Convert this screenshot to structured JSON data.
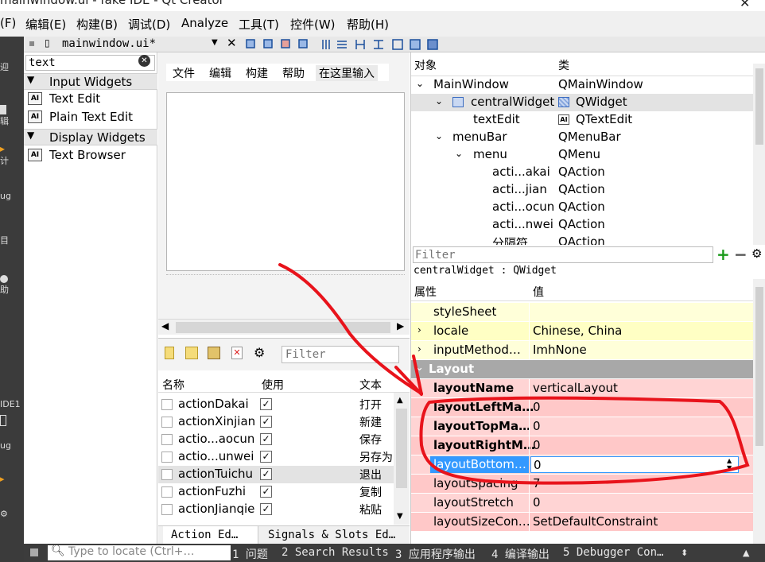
{
  "title_bar": {
    "text": "mainwindow.ui - fake IDE - Qt Creator",
    "close": "✕"
  },
  "menu_bar": [
    "(F)",
    "编辑(E)",
    "构建(B)",
    "调试(D)",
    "Analyze",
    "工具(T)",
    "控件(W)",
    "帮助(H)"
  ],
  "mode_bar": [
    "迎",
    "辑",
    "计",
    "ug",
    "目",
    "助",
    "IDE1",
    "ug"
  ],
  "editor_tab": {
    "file": "mainwindow.ui*"
  },
  "widget_box": {
    "search_value": "text",
    "categories": [
      {
        "label": "Input Widgets",
        "items": [
          "Text Edit",
          "Plain Text Edit"
        ]
      },
      {
        "label": "Display Widgets",
        "items": [
          "Text Browser"
        ]
      }
    ],
    "icon_text": "AI"
  },
  "form": {
    "menu": [
      "文件",
      "编辑",
      "构建",
      "帮助",
      "在这里输入"
    ]
  },
  "action_editor": {
    "filter_placeholder": "Filter",
    "columns": [
      "名称",
      "使用",
      "文本"
    ],
    "rows": [
      {
        "name": "actionDakai",
        "text": "打开"
      },
      {
        "name": "actionXinjian",
        "text": "新建"
      },
      {
        "name": "actio...aocun",
        "text": "保存"
      },
      {
        "name": "actio...unwei",
        "text": "另存为"
      },
      {
        "name": "actionTuichu",
        "text": "退出"
      },
      {
        "name": "actionFuzhi",
        "text": "复制"
      },
      {
        "name": "actionJianqie",
        "text": "粘贴"
      }
    ],
    "tabs": [
      "Action Ed…",
      "Signals & Slots Ed…"
    ]
  },
  "object_inspector": {
    "columns": [
      "对象",
      "类"
    ],
    "rows": [
      {
        "object": "MainWindow",
        "class": "QMainWindow"
      },
      {
        "object": "centralWidget",
        "class": "QWidget"
      },
      {
        "object": "textEdit",
        "class": "QTextEdit"
      },
      {
        "object": "menuBar",
        "class": "QMenuBar"
      },
      {
        "object": "menu",
        "class": "QMenu"
      },
      {
        "object": "acti...akai",
        "class": "QAction"
      },
      {
        "object": "acti...jian",
        "class": "QAction"
      },
      {
        "object": "acti...ocun",
        "class": "QAction"
      },
      {
        "object": "acti...nwei",
        "class": "QAction"
      },
      {
        "object": "分隔符",
        "class": "QAction"
      }
    ]
  },
  "property_editor": {
    "filter_placeholder": "Filter",
    "context": "centralWidget : QWidget",
    "columns": [
      "属性",
      "值"
    ],
    "rows": [
      {
        "name": "styleSheet",
        "value": ""
      },
      {
        "name": "locale",
        "value": "Chinese, China"
      },
      {
        "name": "inputMethod…",
        "value": "ImhNone"
      }
    ],
    "group": "Layout",
    "layout_rows": [
      {
        "name": "layoutName",
        "value": "verticalLayout"
      },
      {
        "name": "layoutLeftMa…",
        "value": "0"
      },
      {
        "name": "layoutTopMa…",
        "value": "0"
      },
      {
        "name": "layoutRightM…",
        "value": "0"
      },
      {
        "name": "layoutBottom…",
        "value": "0"
      },
      {
        "name": "layoutSpacing",
        "value": "7"
      },
      {
        "name": "layoutStretch",
        "value": "0"
      },
      {
        "name": "layoutSizeCon…",
        "value": "SetDefaultConstraint"
      }
    ]
  },
  "status_bar": {
    "locate_placeholder": "Type to locate (Ctrl+…",
    "panes": [
      "1 问题",
      "2 Search Results",
      "3 应用程序输出",
      "4 编译输出",
      "5 Debugger Con…"
    ]
  },
  "colors": {
    "annotation": "#e8131b",
    "selection": "#3399ff"
  }
}
